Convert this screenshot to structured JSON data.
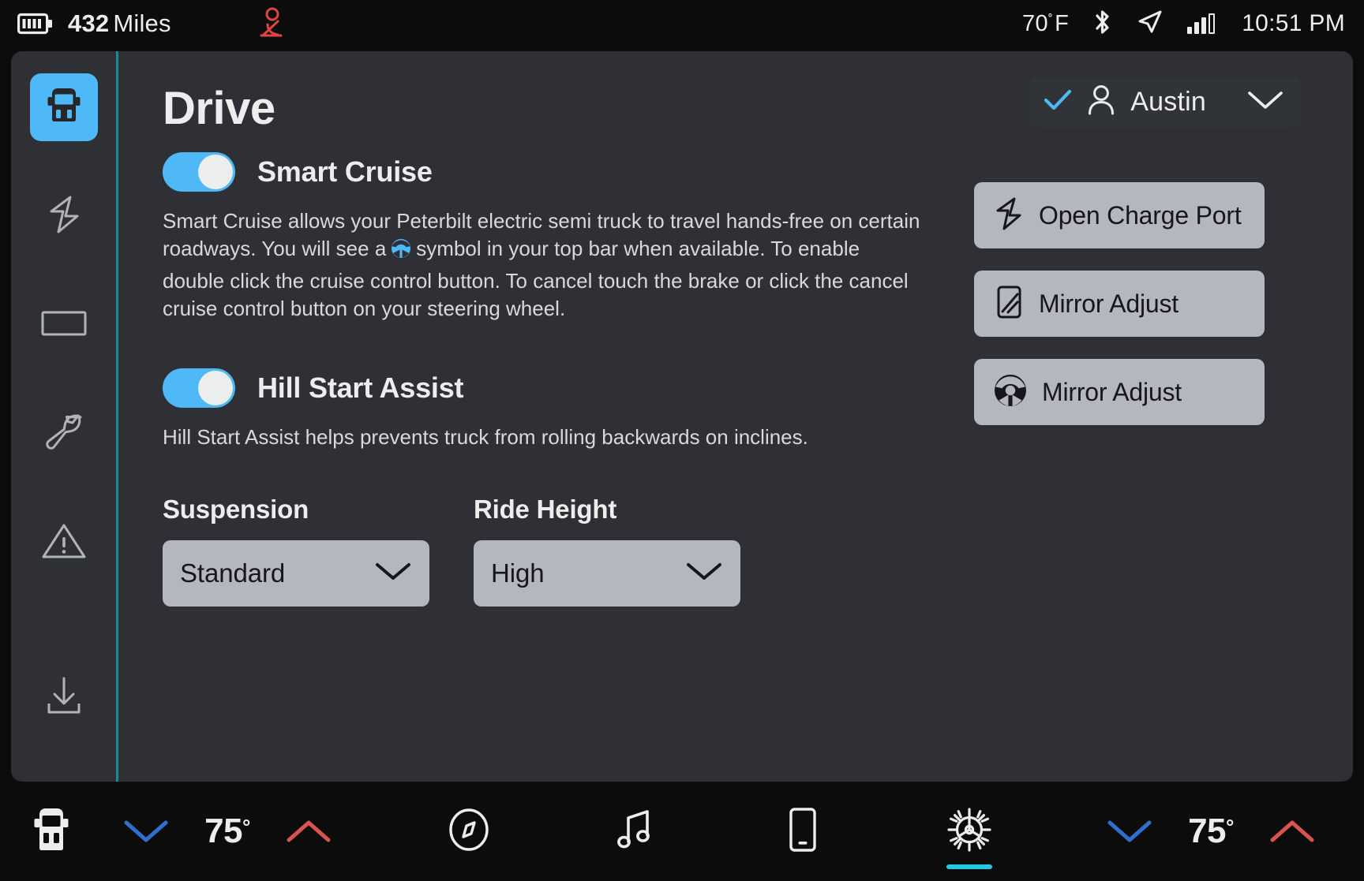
{
  "statusbar": {
    "battery_icon": "battery-icon",
    "range_value": "432",
    "range_unit": "Miles",
    "seatbelt_icon": "seatbelt-warning-icon",
    "seatbelt_color": "#e0453f",
    "temperature": "70",
    "temperature_degree": "˚",
    "temperature_unit": "F",
    "bluetooth_icon": "bluetooth-icon",
    "navigation_icon": "navigation-arrow-icon",
    "signal_icon": "cellular-signal-icon",
    "time": "10:51 PM"
  },
  "sidebar": {
    "accent_color": "#4fb8f7",
    "divider_color": "#1b8a96",
    "items": [
      {
        "name": "truck",
        "icon": "truck-icon",
        "active": true
      },
      {
        "name": "charging",
        "icon": "lightning-bolt-icon",
        "active": false
      },
      {
        "name": "display",
        "icon": "display-rectangle-icon",
        "active": false
      },
      {
        "name": "service",
        "icon": "wrench-icon",
        "active": false
      },
      {
        "name": "alerts",
        "icon": "warning-triangle-icon",
        "active": false
      },
      {
        "name": "software-update",
        "icon": "download-icon",
        "active": false
      }
    ]
  },
  "header": {
    "title": "Drive",
    "profile": {
      "check_icon": "check-icon",
      "check_color": "#4fb8f7",
      "avatar_icon": "person-icon",
      "name": "Austin",
      "chevron_icon": "chevron-down-icon"
    }
  },
  "settings": {
    "smart_cruise": {
      "label": "Smart Cruise",
      "enabled": true,
      "description_part1": "Smart Cruise allows your Peterbilt electric semi truck to travel hands-free on certain roadways. You will see a",
      "inline_icon": "steering-wheel-icon",
      "inline_icon_color": "#4fb8f7",
      "description_part2": "symbol in your top bar when available. To enable double click the cruise control button. To cancel touch the brake or click the cancel cruise control button on your steering wheel."
    },
    "hill_start_assist": {
      "label": "Hill Start Assist",
      "enabled": true,
      "description": "Hill Start Assist helps prevents truck from rolling backwards on inclines."
    },
    "suspension": {
      "caption": "Suspension",
      "value": "Standard",
      "chevron_icon": "chevron-down-icon"
    },
    "ride_height": {
      "caption": "Ride Height",
      "value": "High",
      "chevron_icon": "chevron-down-icon"
    }
  },
  "actions": [
    {
      "label": "Open Charge Port",
      "icon": "lightning-bolt-icon"
    },
    {
      "label": "Mirror Adjust",
      "icon": "mirror-icon"
    },
    {
      "label": "Mirror Adjust",
      "icon": "steering-wheel-icon"
    }
  ],
  "bottombar": {
    "vehicle_icon": "truck-front-icon",
    "left_climate": {
      "down_icon": "chevron-down-icon",
      "down_color": "#2f6fd0",
      "temp": "75",
      "degree": "°",
      "up_icon": "chevron-up-icon",
      "up_color": "#d9534f"
    },
    "center_icons": [
      {
        "name": "navigation",
        "icon": "compass-icon",
        "active": false
      },
      {
        "name": "media",
        "icon": "music-note-icon",
        "active": false
      },
      {
        "name": "phone",
        "icon": "phone-icon",
        "active": false
      },
      {
        "name": "settings",
        "icon": "gear-icon",
        "active": true
      }
    ],
    "active_indicator_color": "#22c7e0",
    "right_climate": {
      "down_icon": "chevron-down-icon",
      "down_color": "#2f6fd0",
      "temp": "75",
      "degree": "°",
      "up_icon": "chevron-up-icon",
      "up_color": "#d9534f"
    }
  }
}
